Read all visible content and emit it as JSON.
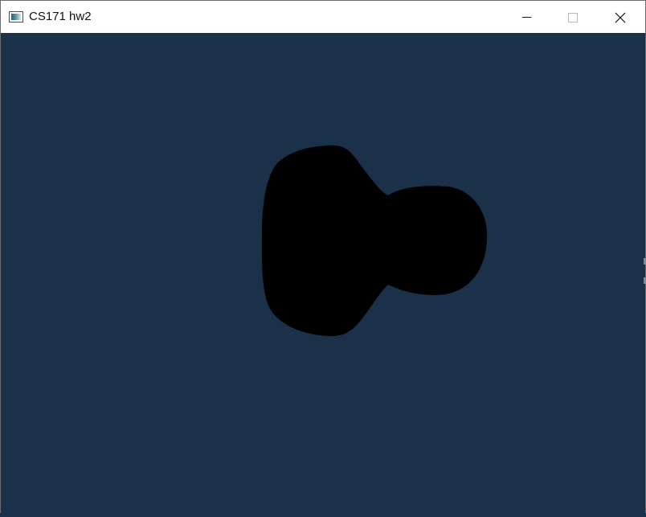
{
  "window": {
    "title": "CS171 hw2",
    "background_color": "#1b3049",
    "shape_color": "#000000"
  },
  "titlebar": {
    "icon": "app-window-icon",
    "buttons": [
      {
        "name": "minimize-button",
        "icon": "minimize-icon"
      },
      {
        "name": "maximize-button",
        "icon": "maximize-icon"
      },
      {
        "name": "close-button",
        "icon": "close-icon"
      }
    ]
  },
  "viewport": {
    "object": "rendered-mesh-silhouette"
  }
}
